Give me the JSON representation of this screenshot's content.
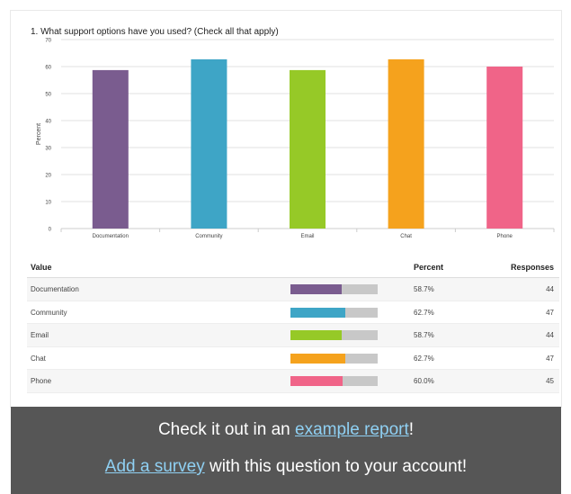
{
  "question": "1. What support options have you used? (Check all that apply)",
  "chart_data": {
    "type": "bar",
    "title": "",
    "xlabel": "",
    "ylabel": "Percent",
    "ylim": [
      0,
      70
    ],
    "yticks": [
      0,
      10,
      20,
      30,
      40,
      50,
      60,
      70
    ],
    "grid": true,
    "categories": [
      "Documentation",
      "Community",
      "Email",
      "Chat",
      "Phone"
    ],
    "values": [
      58.7,
      62.7,
      58.7,
      62.7,
      60.0
    ],
    "colors": [
      "#7a5c8f",
      "#3ea5c6",
      "#96c927",
      "#f5a21d",
      "#f06488"
    ]
  },
  "table": {
    "headers": {
      "value": "Value",
      "percent": "Percent",
      "responses": "Responses"
    },
    "rows": [
      {
        "label": "Documentation",
        "percent": "58.7%",
        "responses": "44",
        "fraction": 0.587,
        "color": "#7a5c8f"
      },
      {
        "label": "Community",
        "percent": "62.7%",
        "responses": "47",
        "fraction": 0.627,
        "color": "#3ea5c6"
      },
      {
        "label": "Email",
        "percent": "58.7%",
        "responses": "44",
        "fraction": 0.587,
        "color": "#96c927"
      },
      {
        "label": "Chat",
        "percent": "62.7%",
        "responses": "47",
        "fraction": 0.627,
        "color": "#f5a21d"
      },
      {
        "label": "Phone",
        "percent": "60.0%",
        "responses": "45",
        "fraction": 0.6,
        "color": "#f06488"
      }
    ]
  },
  "footer": {
    "line1_pre": "Check it out in an ",
    "line1_link": "example report",
    "line1_post": "!",
    "line2_link": "Add a survey",
    "line2_post": " with this question to your account!"
  }
}
